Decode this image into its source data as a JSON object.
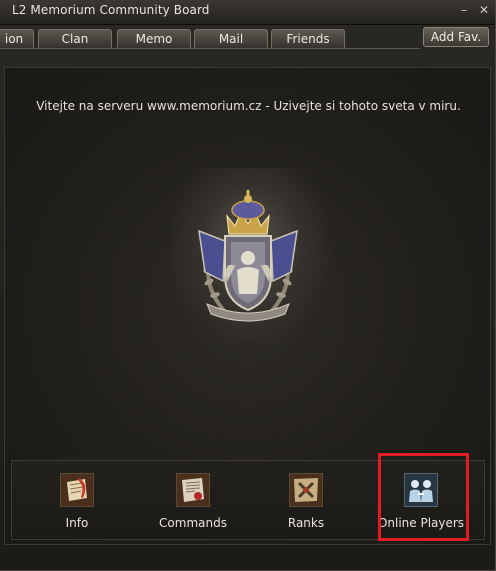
{
  "window": {
    "title": "L2 Memorium Community Board"
  },
  "tabs": [
    {
      "label": "ion"
    },
    {
      "label": "Clan"
    },
    {
      "label": "Memo"
    },
    {
      "label": "Mail"
    },
    {
      "label": "Friends"
    }
  ],
  "toolbar": {
    "add_fav_label": "Add Fav."
  },
  "main": {
    "welcome_text": "Vitejte na serveru www.memorium.cz - Uzivejte si tohoto sveta v miru."
  },
  "shortcuts": [
    {
      "label": "Info",
      "icon": "scroll-quill-icon"
    },
    {
      "label": "Commands",
      "icon": "document-seal-icon"
    },
    {
      "label": "Ranks",
      "icon": "crossed-swords-map-icon"
    },
    {
      "label": "Online Players",
      "icon": "two-players-icon"
    }
  ],
  "colors": {
    "highlight": "#e01c24",
    "background": "#1f1d1a"
  }
}
